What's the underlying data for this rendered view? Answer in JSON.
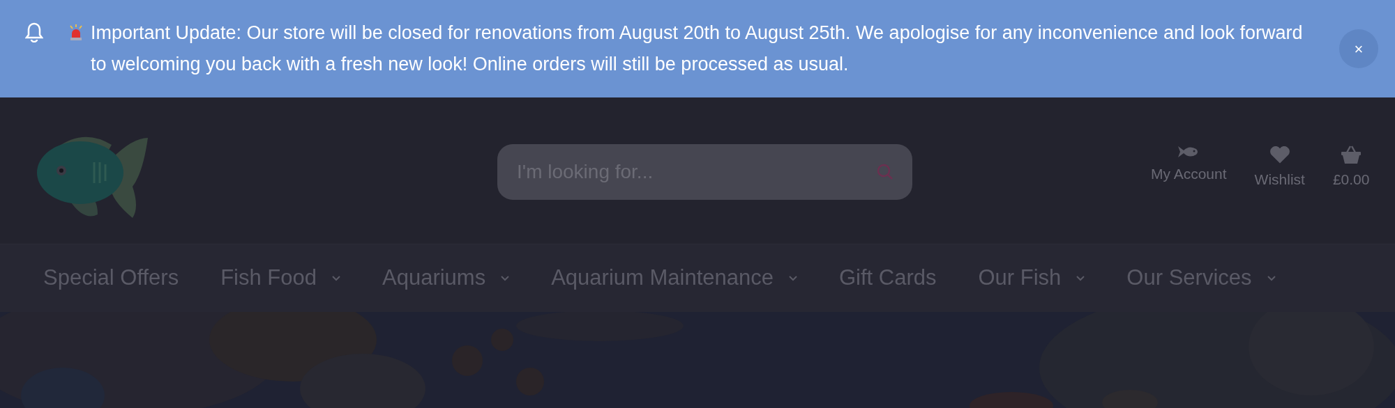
{
  "announcement": {
    "text": "Important Update: Our store will be closed for renovations from August 20th to August 25th. We apologise for any inconvenience and look forward to welcoming you back with a fresh new look! Online orders will still be processed as usual.",
    "close": "×"
  },
  "search": {
    "placeholder": "I'm looking for..."
  },
  "account_links": [
    {
      "kind": "account",
      "label": "My Account"
    },
    {
      "kind": "wishlist",
      "label": "Wishlist"
    },
    {
      "kind": "basket",
      "label": "£0.00"
    }
  ],
  "nav": [
    {
      "label": "Special Offers",
      "has_menu": false
    },
    {
      "label": "Fish Food",
      "has_menu": true
    },
    {
      "label": "Aquariums",
      "has_menu": true
    },
    {
      "label": "Aquarium Maintenance",
      "has_menu": true
    },
    {
      "label": "Gift Cards",
      "has_menu": false
    },
    {
      "label": "Our Fish",
      "has_menu": true
    },
    {
      "label": "Our Services",
      "has_menu": true
    }
  ]
}
